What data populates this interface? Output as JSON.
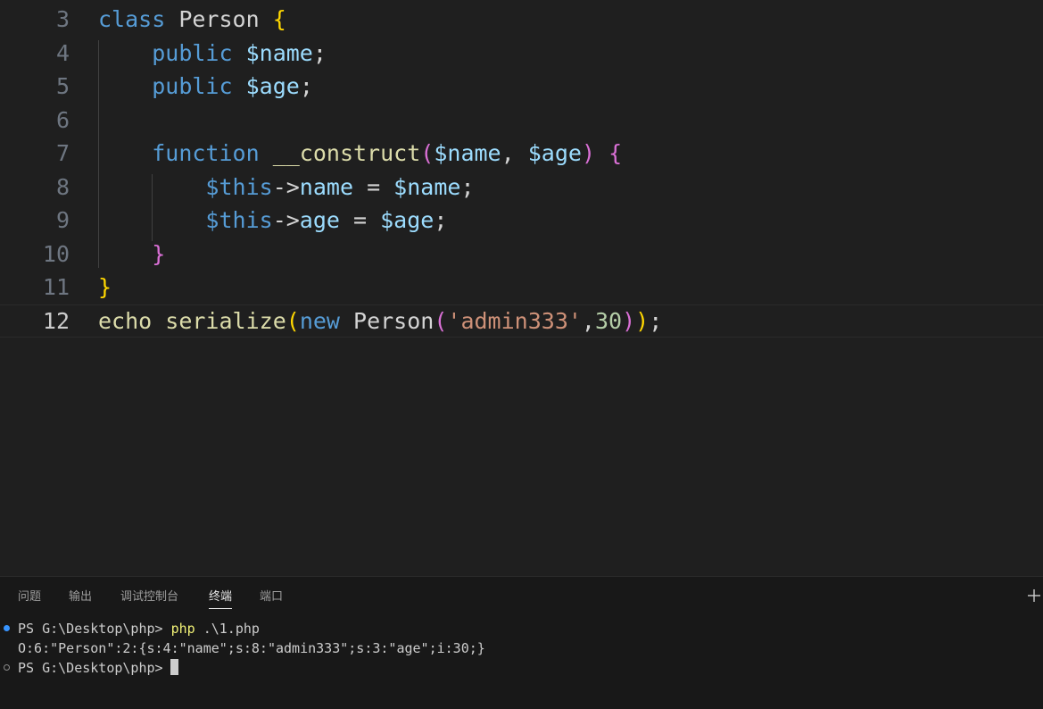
{
  "editor": {
    "lines": [
      {
        "number": "3",
        "tokens": [
          {
            "t": "class",
            "c": "kw"
          },
          {
            "t": " ",
            "c": "plain"
          },
          {
            "t": "Person",
            "c": "plain"
          },
          {
            "t": " ",
            "c": "plain"
          },
          {
            "t": "{",
            "c": "b1"
          }
        ]
      },
      {
        "number": "4",
        "tokens": [
          {
            "t": "    ",
            "c": "plain"
          },
          {
            "t": "public",
            "c": "kw"
          },
          {
            "t": " ",
            "c": "plain"
          },
          {
            "t": "$name",
            "c": "var"
          },
          {
            "t": ";",
            "c": "plain"
          }
        ]
      },
      {
        "number": "5",
        "tokens": [
          {
            "t": "    ",
            "c": "plain"
          },
          {
            "t": "public",
            "c": "kw"
          },
          {
            "t": " ",
            "c": "plain"
          },
          {
            "t": "$age",
            "c": "var"
          },
          {
            "t": ";",
            "c": "plain"
          }
        ]
      },
      {
        "number": "6",
        "tokens": []
      },
      {
        "number": "7",
        "tokens": [
          {
            "t": "    ",
            "c": "plain"
          },
          {
            "t": "function",
            "c": "kw"
          },
          {
            "t": " ",
            "c": "plain"
          },
          {
            "t": "__construct",
            "c": "fn"
          },
          {
            "t": "(",
            "c": "b2"
          },
          {
            "t": "$name",
            "c": "var"
          },
          {
            "t": ", ",
            "c": "plain"
          },
          {
            "t": "$age",
            "c": "var"
          },
          {
            "t": ")",
            "c": "b2"
          },
          {
            "t": " ",
            "c": "plain"
          },
          {
            "t": "{",
            "c": "b2"
          }
        ]
      },
      {
        "number": "8",
        "tokens": [
          {
            "t": "        ",
            "c": "plain"
          },
          {
            "t": "$this",
            "c": "kw"
          },
          {
            "t": "->",
            "c": "plain"
          },
          {
            "t": "name",
            "c": "var"
          },
          {
            "t": " = ",
            "c": "plain"
          },
          {
            "t": "$name",
            "c": "var"
          },
          {
            "t": ";",
            "c": "plain"
          }
        ]
      },
      {
        "number": "9",
        "tokens": [
          {
            "t": "        ",
            "c": "plain"
          },
          {
            "t": "$this",
            "c": "kw"
          },
          {
            "t": "->",
            "c": "plain"
          },
          {
            "t": "age",
            "c": "var"
          },
          {
            "t": " = ",
            "c": "plain"
          },
          {
            "t": "$age",
            "c": "var"
          },
          {
            "t": ";",
            "c": "plain"
          }
        ]
      },
      {
        "number": "10",
        "tokens": [
          {
            "t": "    ",
            "c": "plain"
          },
          {
            "t": "}",
            "c": "b2"
          }
        ]
      },
      {
        "number": "11",
        "tokens": [
          {
            "t": "}",
            "c": "b1"
          }
        ]
      },
      {
        "number": "12",
        "tokens": [
          {
            "t": "echo",
            "c": "fn"
          },
          {
            "t": " ",
            "c": "plain"
          },
          {
            "t": "serialize",
            "c": "fn"
          },
          {
            "t": "(",
            "c": "b1"
          },
          {
            "t": "new",
            "c": "kw"
          },
          {
            "t": " ",
            "c": "plain"
          },
          {
            "t": "Person",
            "c": "plain"
          },
          {
            "t": "(",
            "c": "b2"
          },
          {
            "t": "'admin333'",
            "c": "str"
          },
          {
            "t": ",",
            "c": "plain"
          },
          {
            "t": "30",
            "c": "num"
          },
          {
            "t": ")",
            "c": "b2"
          },
          {
            "t": ")",
            "c": "b1"
          },
          {
            "t": ";",
            "c": "plain"
          }
        ],
        "current": true
      }
    ]
  },
  "panel": {
    "tabs": [
      {
        "label": "问题",
        "active": false
      },
      {
        "label": "输出",
        "active": false
      },
      {
        "label": "调试控制台",
        "active": false
      },
      {
        "label": "终端",
        "active": true
      },
      {
        "label": "端口",
        "active": false
      }
    ],
    "add_icon": "plus-icon"
  },
  "terminal": {
    "line1_prompt": "PS G:\\Desktop\\php> ",
    "line1_cmd": "php",
    "line1_args": " .\\1.php",
    "line2_output": "O:6:\"Person\":2:{s:4:\"name\";s:8:\"admin333\";s:3:\"age\";i:30;}",
    "line3_prompt": "PS G:\\Desktop\\php>"
  },
  "colors": {
    "editor_bg": "#1f1f1f",
    "panel_bg": "#181818",
    "keyword": "#569cd6",
    "variable": "#9cdcfe",
    "function": "#dcdcaa",
    "string": "#ce9178",
    "number": "#b5cea8",
    "bracket_1": "#ffd700",
    "bracket_2": "#da70d6",
    "command": "#f1f176",
    "success_dot": "#3794ff"
  }
}
